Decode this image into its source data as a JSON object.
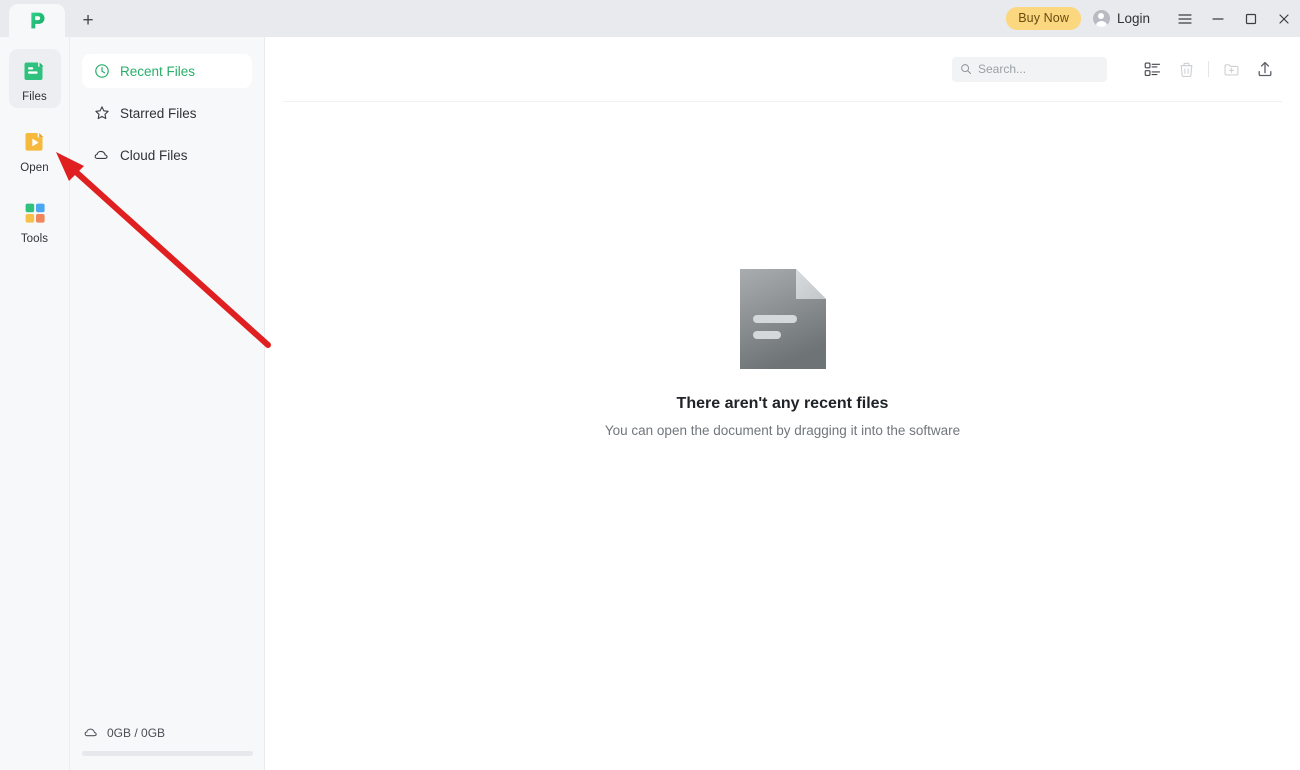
{
  "window": {
    "tab_logo": "app-logo-p",
    "new_tab_label": "+",
    "buy_now_label": "Buy Now",
    "login_label": "Login",
    "menu_icon": "hamburger-menu-icon",
    "minimize_icon": "minimize-icon",
    "maximize_icon": "maximize-icon",
    "close_icon": "close-icon"
  },
  "rail": {
    "items": [
      {
        "label": "Files",
        "icon": "files-icon",
        "active": true
      },
      {
        "label": "Open",
        "icon": "open-file-icon",
        "active": false
      },
      {
        "label": "Tools",
        "icon": "tools-grid-icon",
        "active": false
      }
    ]
  },
  "sidebar": {
    "items": [
      {
        "label": "Recent Files",
        "icon": "clock-icon",
        "active": true
      },
      {
        "label": "Starred Files",
        "icon": "star-icon",
        "active": false
      },
      {
        "label": "Cloud Files",
        "icon": "cloud-icon",
        "active": false
      }
    ],
    "storage": {
      "icon": "cloud-icon",
      "text": "0GB / 0GB",
      "used_percent": 0
    }
  },
  "toolbar": {
    "search_placeholder": "Search...",
    "search_value": "",
    "search_icon": "search-icon",
    "list_view_icon": "list-view-icon",
    "delete_icon": "trash-icon",
    "new_folder_icon": "new-folder-icon",
    "upload_icon": "upload-icon"
  },
  "main": {
    "empty_state": {
      "icon": "document-placeholder-icon",
      "title": "There aren't any recent files",
      "subtitle": "You can open the document by dragging it into the software"
    }
  },
  "annotation": {
    "type": "arrow",
    "color": "#e02020",
    "points_to": "open-file-rail-item"
  },
  "colors": {
    "brand_green": "#27b06a",
    "accent_yellow": "#fbd77f",
    "annotation_red": "#e02020",
    "titlebar_bg": "#e8eaed",
    "sidebar_bg": "#f7f8fa"
  }
}
